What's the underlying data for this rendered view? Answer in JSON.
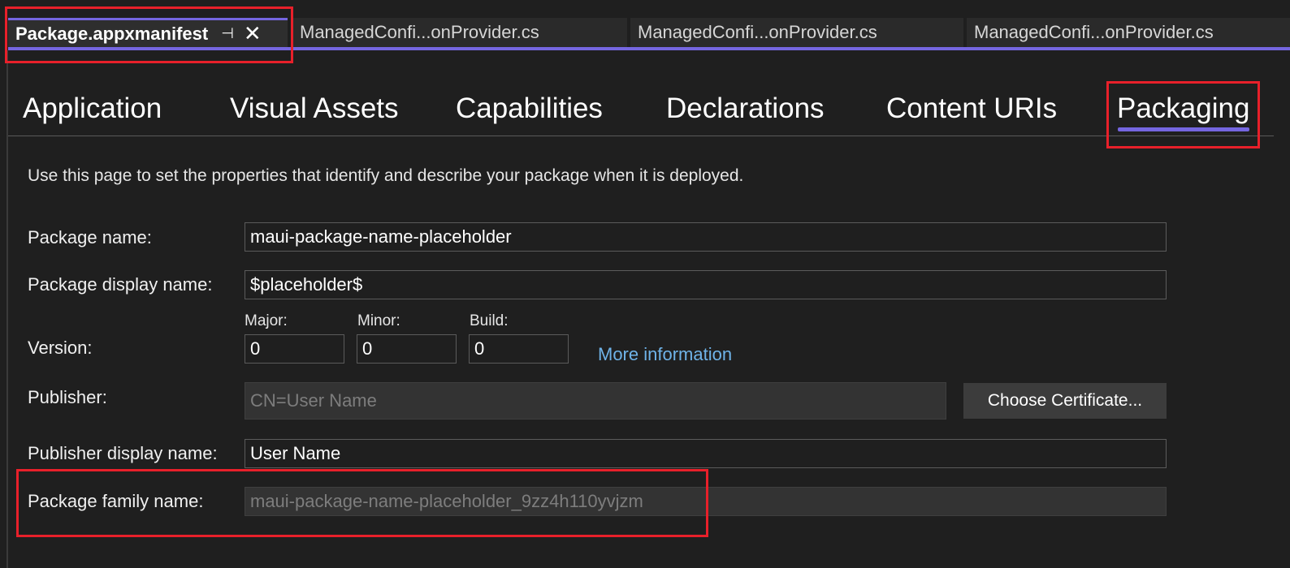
{
  "document_tabs": [
    {
      "label": "Package.appxmanifest",
      "active": true
    },
    {
      "label": "ManagedConfi...onProvider.cs"
    },
    {
      "label": "ManagedConfi...onProvider.cs"
    },
    {
      "label": "ManagedConfi...onProvider.cs"
    }
  ],
  "icons": {
    "pin": "pin-icon",
    "close": "close-icon"
  },
  "page_tabs": [
    "Application",
    "Visual Assets",
    "Capabilities",
    "Declarations",
    "Content URIs",
    "Packaging"
  ],
  "active_page_tab": "Packaging",
  "description": "Use this page to set the properties that identify and describe your package when it is deployed.",
  "form": {
    "package_name": {
      "label": "Package name:",
      "value": "maui-package-name-placeholder"
    },
    "package_display_name": {
      "label": "Package display name:",
      "value": "$placeholder$"
    },
    "version": {
      "label": "Version:",
      "major": {
        "label": "Major:",
        "value": "0"
      },
      "minor": {
        "label": "Minor:",
        "value": "0"
      },
      "build": {
        "label": "Build:",
        "value": "0"
      },
      "more_info": "More information"
    },
    "publisher": {
      "label": "Publisher:",
      "value": "CN=User Name",
      "button": "Choose Certificate..."
    },
    "publisher_display_name": {
      "label": "Publisher display name:",
      "value": "User Name"
    },
    "package_family_name": {
      "label": "Package family name:",
      "value": "maui-package-name-placeholder_9zz4h110yvjzm"
    }
  },
  "colors": {
    "accent": "#7566e0",
    "highlight": "#e8202a",
    "link": "#6fb3e8",
    "background": "#1f1f1f"
  }
}
